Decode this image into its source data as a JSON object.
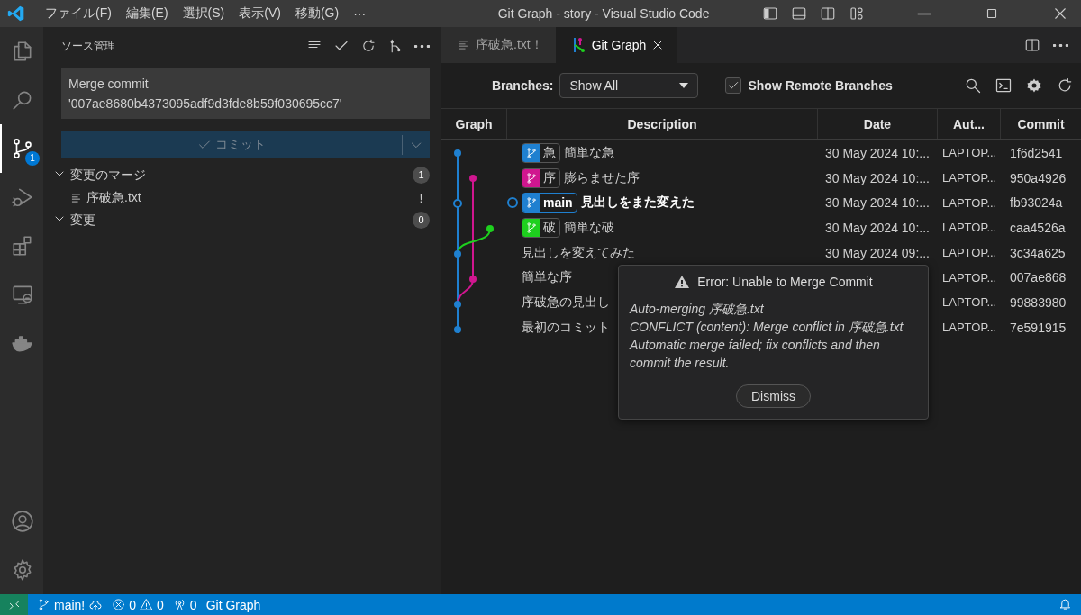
{
  "title_bar": {
    "menu": [
      "ファイル(F)",
      "編集(E)",
      "選択(S)",
      "表示(V)",
      "移動(G)",
      "···"
    ],
    "title": "Git Graph - story - Visual Studio Code"
  },
  "activity_bar": {
    "top": [
      {
        "kind": "files",
        "selected": false
      },
      {
        "kind": "search",
        "selected": false
      },
      {
        "kind": "scm",
        "selected": true,
        "badge": "1"
      },
      {
        "kind": "debug",
        "selected": false
      },
      {
        "kind": "extensions",
        "selected": false
      },
      {
        "kind": "remote",
        "selected": false
      },
      {
        "kind": "docker",
        "selected": false
      }
    ],
    "bottom": [
      {
        "kind": "account",
        "selected": false
      },
      {
        "kind": "settings",
        "selected": false
      }
    ]
  },
  "sidebar": {
    "title": "ソース管理",
    "message": "Merge commit\n'007ae8680b4373095adf9d3fde8b59f030695cc7'",
    "commit_button": {
      "label": "コミット",
      "disabled": true
    },
    "groups": [
      {
        "label": "変更のマージ",
        "count": "1",
        "expanded": true,
        "files": [
          {
            "name": "序破急.txt",
            "status": "!"
          }
        ]
      },
      {
        "label": "変更",
        "count": "0",
        "expanded": true
      }
    ]
  },
  "tabs": [
    {
      "label": "序破急.txt！",
      "kind": "file",
      "selected": false
    },
    {
      "label": "Git Graph",
      "kind": "graph",
      "selected": true
    }
  ],
  "toolbar": {
    "branches_label": "Branches:",
    "branches_value": "Show All",
    "remote_checkbox": {
      "label": "Show Remote Branches",
      "checked": true
    }
  },
  "table": {
    "columns": [
      "Graph",
      "Description",
      "Date",
      "Aut...",
      "Commit"
    ],
    "rows": [
      {
        "description": "簡単な急",
        "head": false,
        "tags": [
          {
            "name": "急",
            "color": "#1f80d0"
          }
        ],
        "date": "30 May 2024 10:...",
        "author": "LAPTOP...",
        "commit": "1f6d2541"
      },
      {
        "description": "膨らませた序",
        "head": false,
        "tags": [
          {
            "name": "序",
            "color": "#d0168f"
          }
        ],
        "date": "30 May 2024 10:...",
        "author": "LAPTOP...",
        "commit": "950a4926"
      },
      {
        "description": "見出しをまた変えた",
        "head": true,
        "tags": [
          {
            "name": "main",
            "color": "#1f80d0"
          }
        ],
        "date": "30 May 2024 10:...",
        "author": "LAPTOP...",
        "commit": "fb93024a"
      },
      {
        "description": "簡単な破",
        "head": false,
        "tags": [
          {
            "name": "破",
            "color": "#1ed01e"
          }
        ],
        "date": "30 May 2024 10:...",
        "author": "LAPTOP...",
        "commit": "caa4526a"
      },
      {
        "description": "見出しを変えてみた",
        "head": false,
        "date": "30 May 2024 09:...",
        "author": "LAPTOP...",
        "commit": "3c34a625"
      },
      {
        "description": "簡単な序",
        "head": false,
        "author": "LAPTOP...",
        "commit": "007ae868"
      },
      {
        "description": "序破急の見出し",
        "head": false,
        "author": "LAPTOP...",
        "commit": "99883980"
      },
      {
        "description": "最初のコミット",
        "head": false,
        "author": "LAPTOP...",
        "commit": "7e591915"
      }
    ]
  },
  "dialog": {
    "title": "Error: Unable to Merge Commit",
    "message": "Auto-merging 序破急.txt\nCONFLICT (content): Merge conflict in 序破急.txt\nAutomatic merge failed; fix conflicts and then commit the result.",
    "button": "Dismiss"
  },
  "status_bar": {
    "branch": "main!",
    "errors": "0",
    "warnings": "0",
    "ports": "0",
    "extension": "Git Graph"
  }
}
